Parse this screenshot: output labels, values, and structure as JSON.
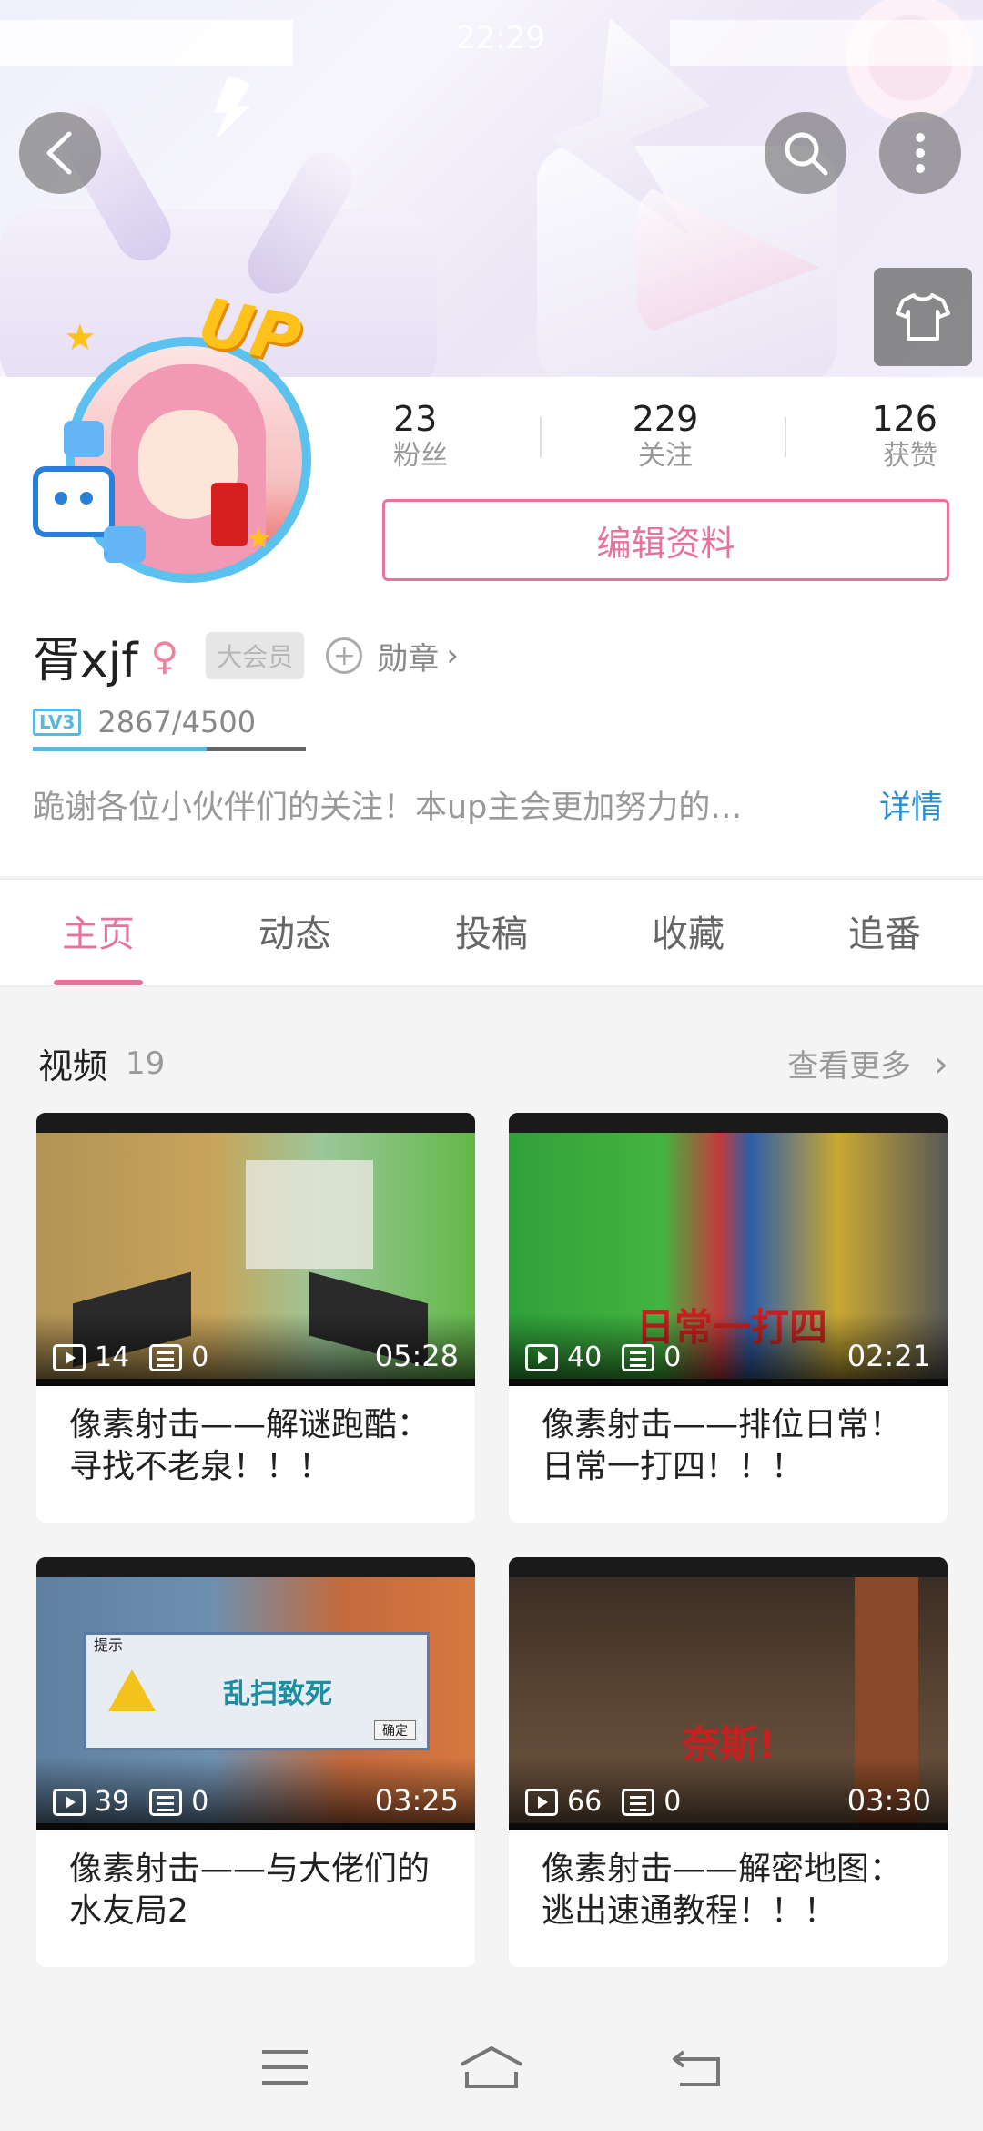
{
  "status_bar": {
    "time": "22:29"
  },
  "header": {
    "back_icon": "back-arrow-icon",
    "search_icon": "search-icon",
    "more_icon": "more-vertical-icon",
    "dress_icon": "tshirt-icon"
  },
  "profile": {
    "avatar_badge": "UP",
    "stats": [
      {
        "value": "23",
        "label": "粉丝"
      },
      {
        "value": "229",
        "label": "关注"
      },
      {
        "value": "126",
        "label": "获赞"
      }
    ],
    "edit_button": "编辑资料",
    "name": "胥xjf",
    "gender_icon": "female-icon",
    "vip_label": "大会员",
    "medal_label": "勋章",
    "level": "LV3",
    "exp_text": "2867/4500",
    "exp_fraction": 0.637,
    "bio": "跪谢各位小伙伴们的关注！本up主会更加努力的…",
    "bio_link": "详情"
  },
  "tabs": [
    {
      "label": "主页",
      "active": true
    },
    {
      "label": "动态",
      "active": false
    },
    {
      "label": "投稿",
      "active": false
    },
    {
      "label": "收藏",
      "active": false
    },
    {
      "label": "追番",
      "active": false
    }
  ],
  "videos": {
    "section_title": "视频",
    "count": "19",
    "more_label": "查看更多",
    "items": [
      {
        "plays": "14",
        "danmaku": "0",
        "duration": "05:28",
        "title": "像素射击——解谜跑酷：寻找不老泉！！！"
      },
      {
        "plays": "40",
        "danmaku": "0",
        "duration": "02:21",
        "title": "像素射击——排位日常！日常一打四！！！",
        "overlay_text": "日常一打四"
      },
      {
        "plays": "39",
        "danmaku": "0",
        "duration": "03:25",
        "title": "像素射击——与大佬们的水友局2",
        "dialog_title": "提示",
        "dialog_text": "乱扫致死",
        "dialog_button": "确定"
      },
      {
        "plays": "66",
        "danmaku": "0",
        "duration": "03:30",
        "title": "像素射击——解密地图：逃出速通教程！！！",
        "overlay_text": "奈斯!"
      }
    ]
  },
  "navbar": {
    "menu_icon": "menu-icon",
    "home_icon": "home-icon",
    "back_icon": "return-icon"
  }
}
